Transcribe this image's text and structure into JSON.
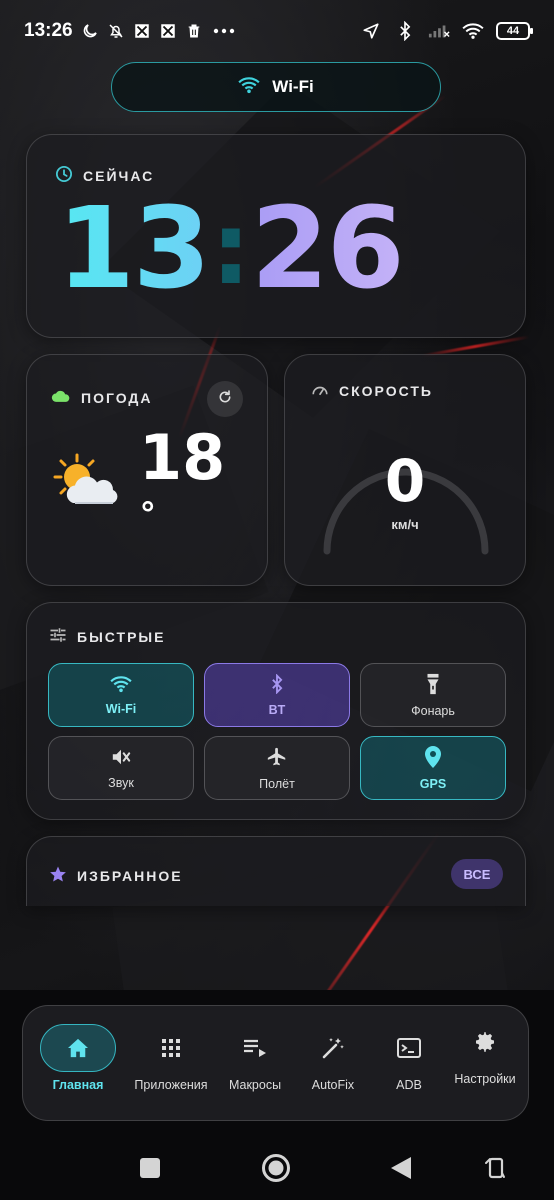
{
  "status_bar": {
    "time": "13:26",
    "battery": "44",
    "left_icons": [
      "moon-icon",
      "bell-off-icon",
      "app-icon",
      "app-icon",
      "trash-icon",
      "more-icon"
    ],
    "right_icons": [
      "location-icon",
      "bluetooth-icon",
      "no-signal-icon",
      "wifi-icon",
      "battery-icon"
    ]
  },
  "connection_pill": {
    "label": "Wi-Fi",
    "icon": "wifi-icon"
  },
  "now_card": {
    "title": "СЕЙЧАС",
    "hours": "13",
    "separator": ":",
    "minutes": "26"
  },
  "weather_card": {
    "title": "ПОГОДА",
    "temperature": "18",
    "degree": "°",
    "icon": "sun-behind-cloud"
  },
  "speed_card": {
    "title": "СКОРОСТЬ",
    "value": "0",
    "unit": "км/ч",
    "level": 0
  },
  "quick_card": {
    "title": "БЫСТРЫЕ",
    "buttons": [
      {
        "label": "Wi-Fi",
        "icon": "wifi-icon",
        "active": true
      },
      {
        "label": "BT",
        "icon": "bluetooth-icon",
        "active": true
      },
      {
        "label": "Фонарь",
        "icon": "flashlight-icon",
        "active": false
      },
      {
        "label": "Звук",
        "icon": "volume-off-icon",
        "active": false
      },
      {
        "label": "Полёт",
        "icon": "airplane-icon",
        "active": false
      },
      {
        "label": "GPS",
        "icon": "location-pin-icon",
        "active": true
      }
    ]
  },
  "favorites_card": {
    "title": "ИЗБРАННОЕ",
    "all_button": "ВСЕ"
  },
  "bottom_nav": {
    "items": [
      {
        "label": "Главная",
        "icon": "home-icon",
        "active": true
      },
      {
        "label": "Приложения",
        "icon": "apps-grid-icon",
        "active": false
      },
      {
        "label": "Макросы",
        "icon": "playlist-icon",
        "active": false
      },
      {
        "label": "AutoFix",
        "icon": "magic-wand-icon",
        "active": false
      },
      {
        "label": "ADB",
        "icon": "terminal-icon",
        "active": false
      },
      {
        "label": "Настройки",
        "icon": "gear-icon",
        "active": false
      }
    ]
  },
  "colors": {
    "teal": "#37b8c2",
    "purple": "#8b79e6",
    "clock_hours": "#56e8f2",
    "clock_minutes": "#b3a6f6"
  }
}
